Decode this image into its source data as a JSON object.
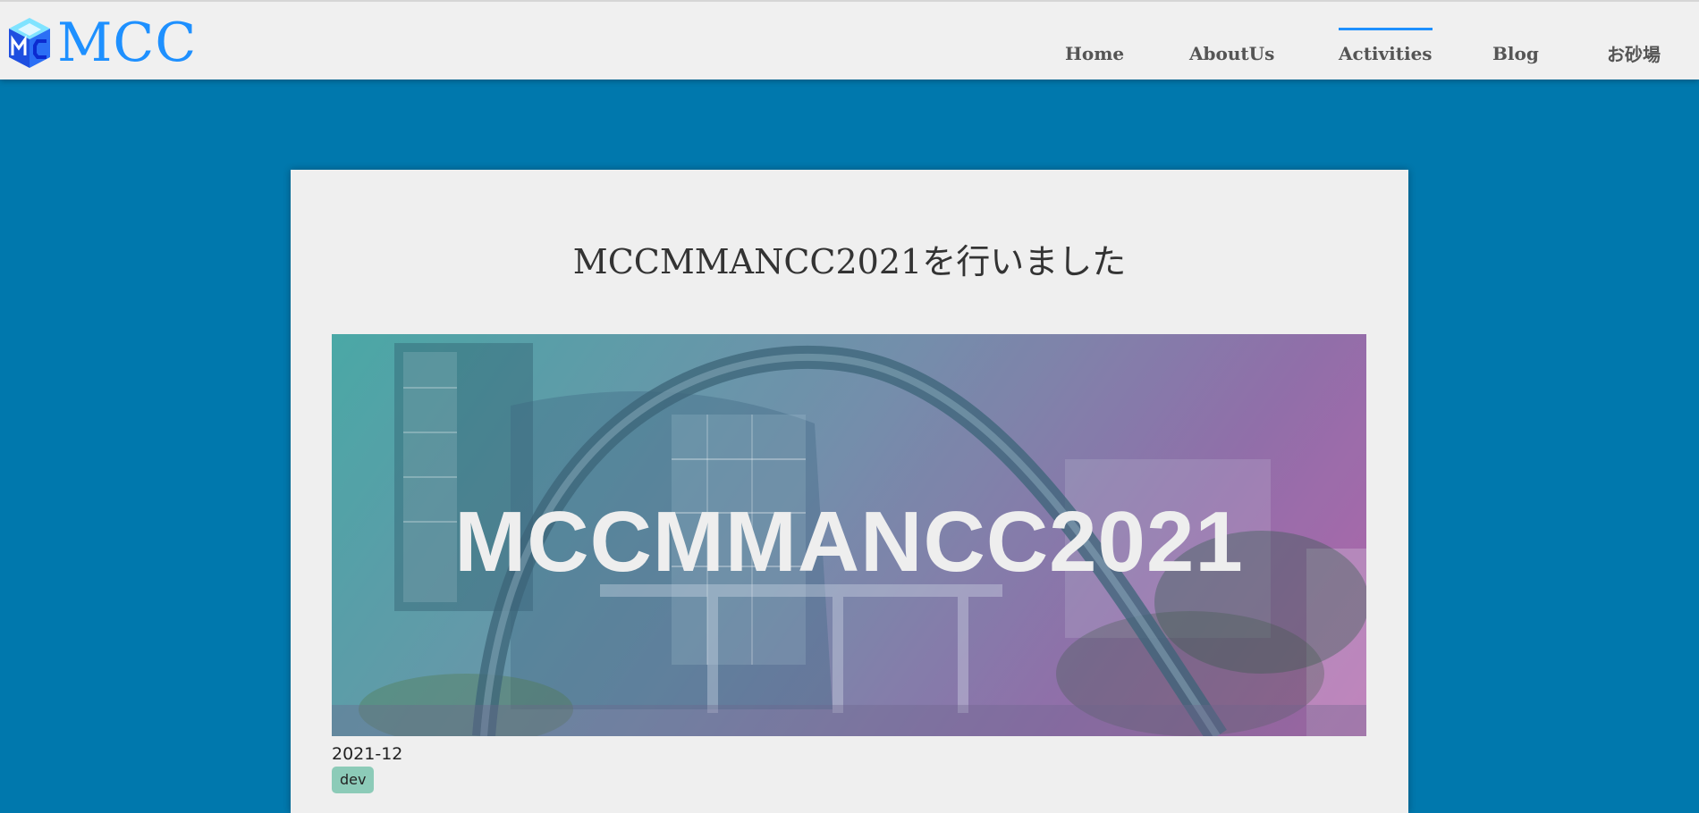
{
  "header": {
    "logo_text": "MCC",
    "brand_color": "#1e90ff",
    "background": "#f0f0f0"
  },
  "nav": {
    "items": [
      {
        "label": "Home",
        "active": false
      },
      {
        "label": "AboutUs",
        "active": false
      },
      {
        "label": "Activities",
        "active": true
      },
      {
        "label": "Blog",
        "active": false
      },
      {
        "label": "お砂場",
        "active": false
      }
    ],
    "active_indicator_color": "#1e90ff"
  },
  "page": {
    "background": "#0078ad"
  },
  "post": {
    "title": "MCCMMANCC2021を行いました",
    "hero_text": "MCCMMANCC2021",
    "date": "2021-12",
    "tags": [
      {
        "label": "dev",
        "color": "#8ccbb8"
      }
    ]
  }
}
